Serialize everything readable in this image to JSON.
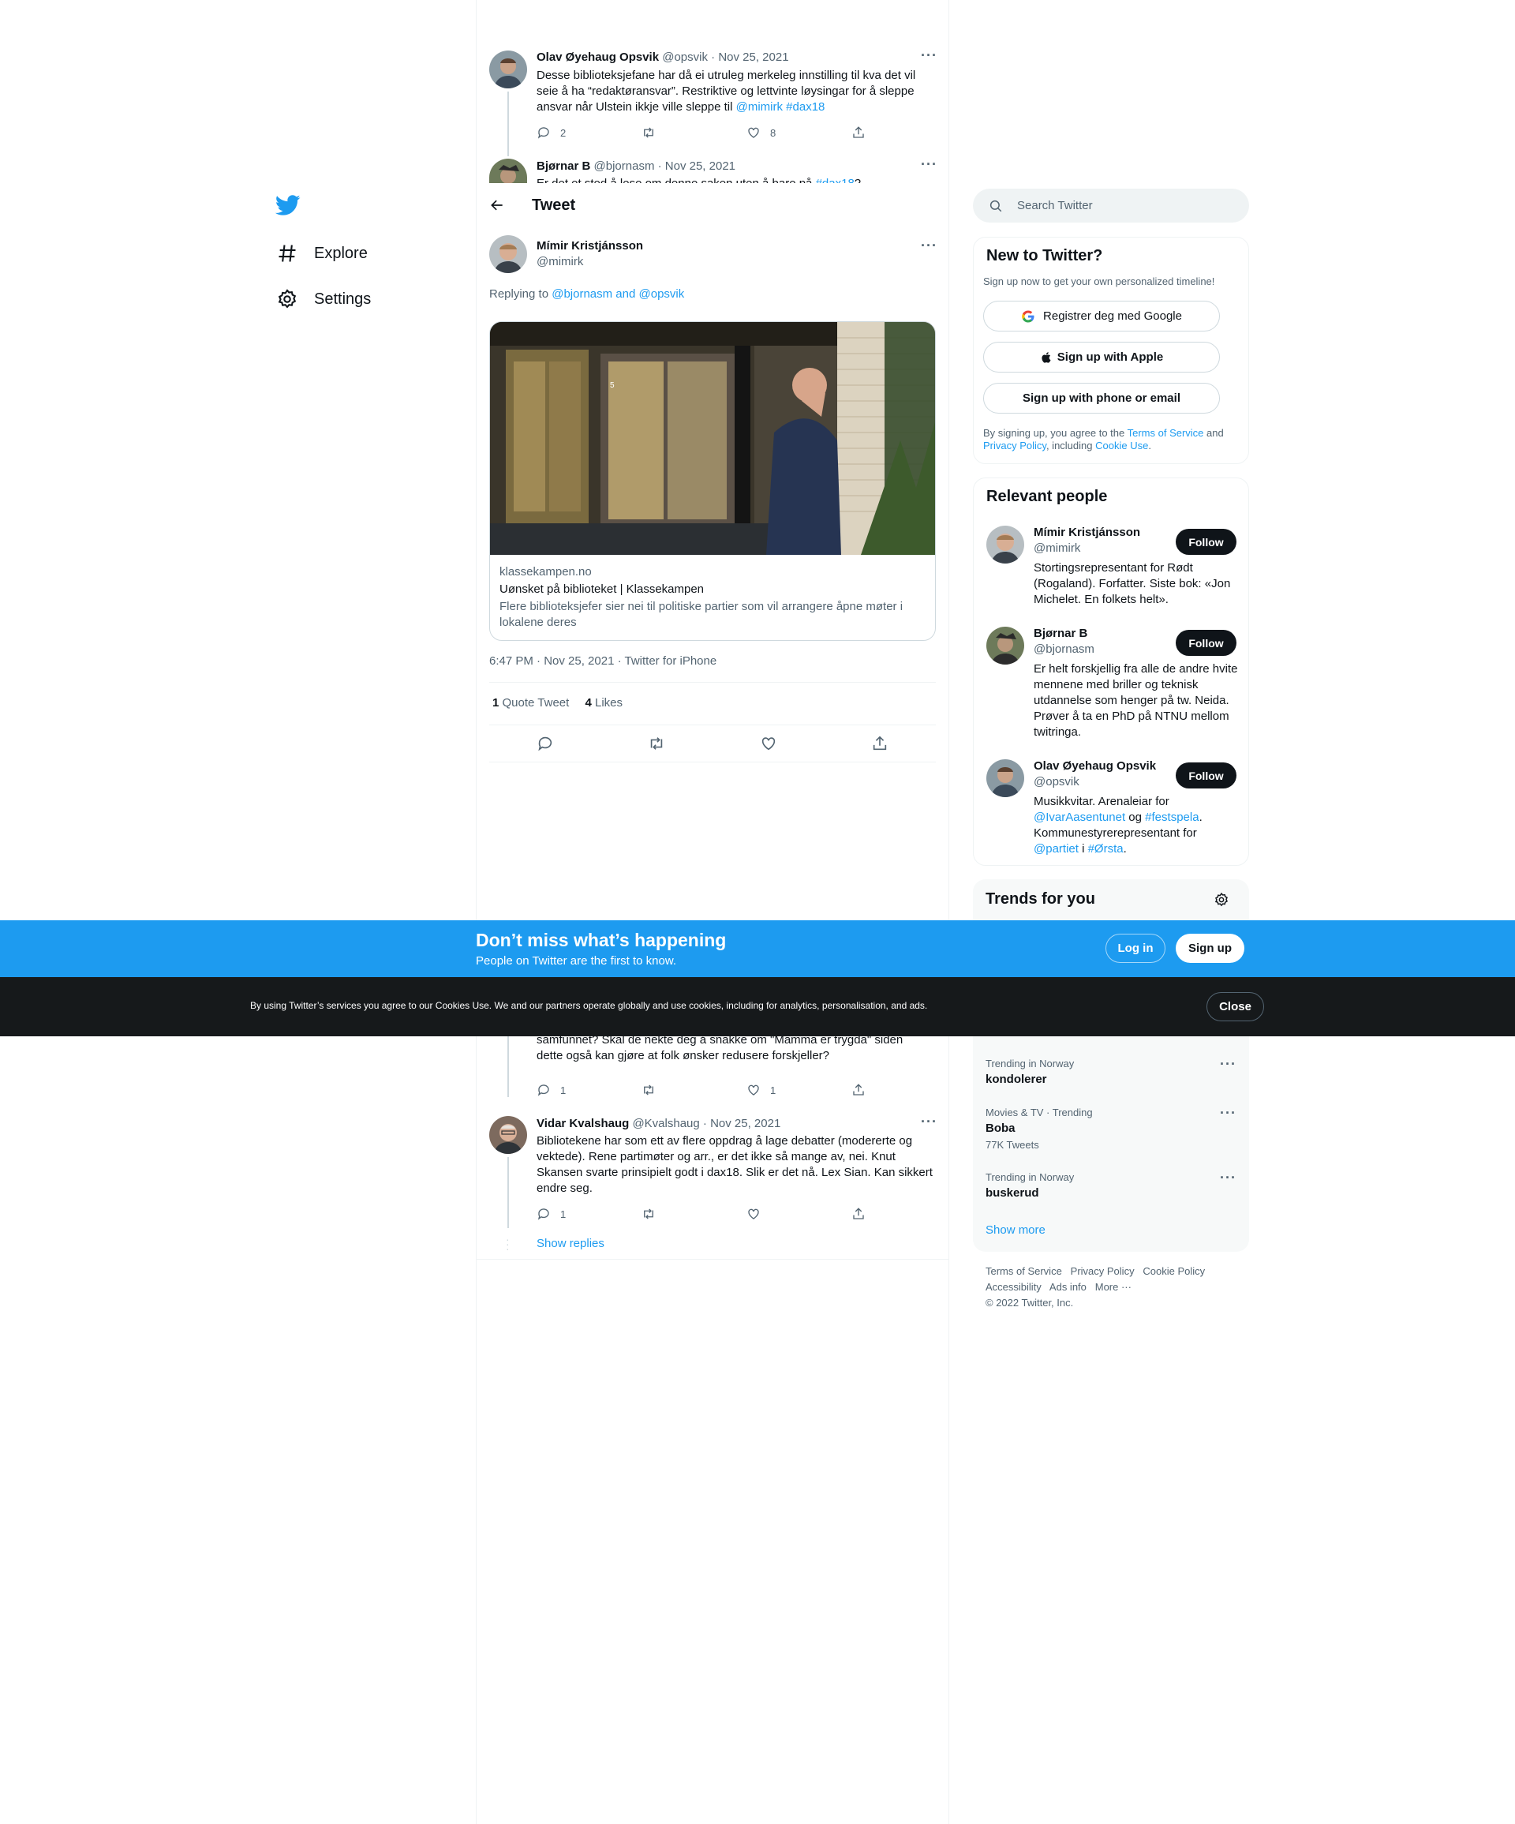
{
  "nav": {
    "items": [
      {
        "label": "Explore",
        "icon": "hashtag-icon"
      },
      {
        "label": "Settings",
        "icon": "gear-icon"
      }
    ]
  },
  "thread_top": [
    {
      "name": "Olav Øyehaug Opsvik",
      "handle": "@opsvik",
      "date": "· Nov 25, 2021",
      "text_parts": [
        "Desse biblioteksjefane har då ei utruleg merkeleg innstilling til kva det vil seie å ha “redaktøransvar”. Restriktive og lettvinte løysingar for å sleppe ansvar når Ulstein ikkje ville sleppe til ",
        "@mimirk",
        " ",
        "#dax18"
      ],
      "replies": "2",
      "retweets": "",
      "likes": "8"
    },
    {
      "name": "Bjørnar B",
      "handle": "@bjornasm",
      "date": "· Nov 25, 2021",
      "text_parts": [
        "Er det et sted å lese om denne saken uten å bare på ",
        "#dax18",
        "?"
      ]
    }
  ],
  "header": {
    "title": "Tweet"
  },
  "main_tweet": {
    "name": "Mímir Kristjánsson",
    "handle": "@mimirk",
    "replying_prefix": "Replying to ",
    "replying_to": "@bjornasm and @opsvik",
    "card": {
      "domain": "klassekampen.no",
      "title": "Uønsket på biblioteket | Klassekampen",
      "description": "Flere biblioteksjefer sier nei til politiske partier som vil arrangere åpne møter i lokalene deres"
    },
    "meta": "6:47 PM · Nov 25, 2021 · Twitter for iPhone",
    "quote_count": "1",
    "quote_label": "Quote Tweet",
    "likes_count": "4",
    "likes_label": "Likes"
  },
  "replies": [
    {
      "text": "samfunnet? Skal de nekte deg å snakke om \"Mamma er trygda\" siden dette også kan gjøre at folk ønsker redusere forskjeller?",
      "replies": "1",
      "retweets": "",
      "likes": "1"
    },
    {
      "name": "Vidar Kvalshaug",
      "handle": "@Kvalshaug",
      "date": "· Nov 25, 2021",
      "text": "Bibliotekene har som ett av flere oppdrag å lage debatter (modererte og vektede). Rene partimøter og arr., er det ikke så mange av, nei. Knut Skansen svarte prinsipielt godt i dax18. Slik er det nå. Lex Sian. Kan sikkert endre seg.",
      "replies": "1",
      "retweets": "",
      "likes": "",
      "show_replies": "Show replies"
    }
  ],
  "search": {
    "placeholder": "Search Twitter"
  },
  "new_to_twitter": {
    "title": "New to Twitter?",
    "subtitle": "Sign up now to get your own personalized timeline!",
    "google": "Registrer deg med Google",
    "apple": "Sign up with Apple",
    "phone": "Sign up with phone or email",
    "legal_1": "By signing up, you agree to the ",
    "terms": "Terms of Service",
    "legal_2": " and ",
    "privacy": "Privacy Policy",
    "legal_3": ", including ",
    "cookie": "Cookie Use",
    "legal_4": "."
  },
  "relevant": {
    "title": "Relevant people",
    "follow_label": "Follow",
    "people": [
      {
        "name": "Mímir Kristjánsson",
        "handle": "@mimirk",
        "bio": "Stortingsrepresentant for Rødt (Rogaland). Forfatter. Siste bok: «Jon Michelet. En folkets helt»."
      },
      {
        "name": "Bjørnar B",
        "handle": "@bjornasm",
        "bio": "Er helt forskjellig fra alle de andre hvite mennene med briller og teknisk utdannelse som henger på tw. Neida. Prøver å ta en PhD på NTNU mellom twitringa."
      },
      {
        "name": "Olav Øyehaug Opsvik",
        "handle": "@opsvik",
        "bio_1": "Musikkvitar. Arenaleiar for ",
        "bio_link1": "@IvarAasentunet",
        "bio_2": " og ",
        "bio_link2": "#festspela",
        "bio_3": ". Kommunestyrerepresentant for ",
        "bio_link3": "@partiet",
        "bio_4": " i ",
        "bio_link4": "#Ørsta",
        "bio_5": "."
      }
    ]
  },
  "trends": {
    "title": "Trends for you",
    "items": [
      {
        "context": "Trending in Norway",
        "name": "kondolerer",
        "count": ""
      },
      {
        "context": "Movies & TV · Trending",
        "name": "Boba",
        "count": "77K Tweets"
      },
      {
        "context": "Trending in Norway",
        "name": "buskerud",
        "count": ""
      }
    ],
    "show_more": "Show more"
  },
  "footer": {
    "links": [
      "Terms of Service",
      "Privacy Policy",
      "Cookie Policy",
      "Accessibility",
      "Ads info",
      "More ···"
    ],
    "copyright": "© 2022 Twitter, Inc."
  },
  "banner": {
    "title": "Don’t miss what’s happening",
    "subtitle": "People on Twitter are the first to know.",
    "login": "Log in",
    "signup": "Sign up"
  },
  "cookie_bar": {
    "text": "By using Twitter’s services you agree to our Cookies Use. We and our partners operate globally and use cookies, including for analytics, personalisation, and ads.",
    "close": "Close"
  },
  "colors": {
    "accent": "#1d9bf0",
    "text": "#0f1419",
    "muted": "#536471",
    "border": "#eff3f4",
    "dark_bar": "#16191b"
  }
}
